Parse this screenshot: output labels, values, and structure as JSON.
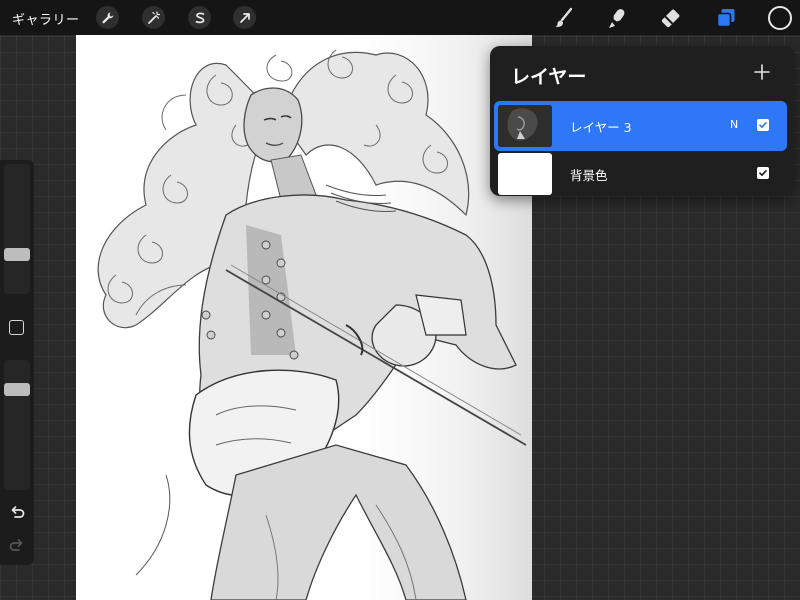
{
  "topbar": {
    "gallery_label": "ギャラリー",
    "left_tools": [
      "wrench-icon",
      "magic-wand-icon",
      "selection-icon",
      "transform-arrow-icon"
    ],
    "right_tools": [
      "brush-icon",
      "smudge-icon",
      "eraser-icon",
      "layers-icon"
    ],
    "active_tool": "layers-icon",
    "accent_color": "#2e77f6",
    "current_color": "#151515"
  },
  "sidebar": {
    "icons": [
      "undo-icon",
      "redo-icon"
    ],
    "brush_size_level": 0.72,
    "opacity_level": 0.2
  },
  "layers_panel": {
    "title": "レイヤー",
    "layers": [
      {
        "name": "レイヤー 3",
        "blend_mode": "N",
        "visible": true,
        "active": true
      },
      {
        "name": "背景色",
        "blend_mode": "",
        "visible": true,
        "active": false
      }
    ]
  }
}
